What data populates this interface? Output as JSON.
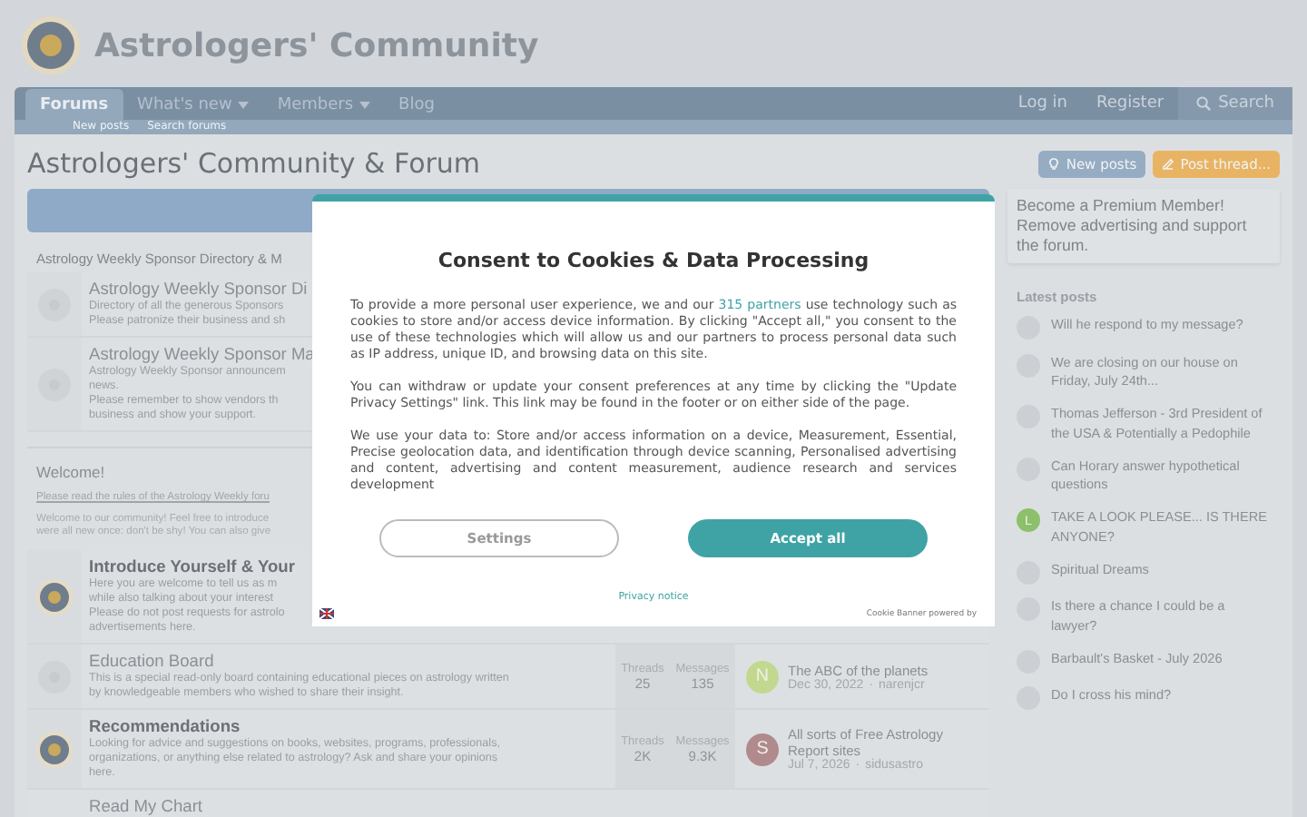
{
  "site": {
    "title": "Astrologers' Community"
  },
  "nav": {
    "tabs": [
      {
        "label": "Forums",
        "selected": true,
        "dropdown": false
      },
      {
        "label": "What's new",
        "selected": false,
        "dropdown": true
      },
      {
        "label": "Members",
        "selected": false,
        "dropdown": true
      },
      {
        "label": "Blog",
        "selected": false,
        "dropdown": false
      }
    ],
    "subnav": [
      "New posts",
      "Search forums"
    ],
    "actions": [
      "Log in",
      "Register"
    ],
    "search": "Search"
  },
  "page": {
    "title": "Astrologers' Community & Forum",
    "buttons": [
      {
        "label": "New posts",
        "kind": "secondary"
      },
      {
        "label": "Post thread...",
        "kind": "primary"
      }
    ]
  },
  "category": {
    "title": "Astrology Weekly Sponsor Directory & M",
    "forums": [
      {
        "title": "Astrology Weekly Sponsor Di",
        "unread": false,
        "lines": [
          "Directory of all the generous Sponsors",
          "Please patronize their business and sh"
        ]
      },
      {
        "title": "Astrology Weekly Sponsor Ma",
        "unread": false,
        "lines": [
          "Astrology Weekly Sponsor announcem",
          "news.",
          "Please remember to show vendors th",
          "business and show your support."
        ]
      }
    ]
  },
  "welcome": {
    "title": "Welcome!",
    "link": "Please read the rules of the Astrology Weekly foru",
    "lines": [
      "Welcome to our community! Feel free to introduce",
      "were all new once: don't be shy! You can also give"
    ]
  },
  "forums": [
    {
      "title": "Introduce Yourself & Your",
      "unread": true,
      "lines": [
        "Here you are welcome to tell us as m",
        "while also talking about your interest",
        "Please do not post requests for astrolo",
        "advertisements here."
      ]
    },
    {
      "title": "Education Board",
      "unread": false,
      "lines": [
        "This is a special read-only board containing educational pieces on astrology written",
        "by knowledgeable members who wished to share their insight."
      ],
      "threads_label": "Threads",
      "threads": "25",
      "messages_label": "Messages",
      "messages": "135",
      "last_post": {
        "title": "The ABC of the planets",
        "date": "Dec 30, 2022",
        "separator": "·",
        "user": "narenjcr",
        "avatar": {
          "letter": "N",
          "color": "#c3d88f"
        }
      }
    },
    {
      "title": "Recommendations",
      "unread": true,
      "lines": [
        "Looking for advice and suggestions on books, websites, programs, professionals,",
        "organizations, or anything else related to astrology? Ask and share your opinions",
        "here."
      ],
      "threads_label": "Threads",
      "threads": "2K",
      "messages_label": "Messages",
      "messages": "9.3K",
      "last_post": {
        "title": "All sorts of Free Astrology Report sites",
        "date": "Jul 7, 2026",
        "separator": "·",
        "user": "sidusastro",
        "avatar": {
          "letter": "S",
          "color": "#b08a8d"
        }
      }
    },
    {
      "title": "Read My Chart"
    }
  ],
  "sidebar": {
    "promo": "Become a Premium Member! Remove advertising and support the forum.",
    "latest_title": "Latest posts",
    "posts": [
      {
        "title": "Will he respond to my message?"
      },
      {
        "title": "We are closing on our house on Friday, July 24th..."
      },
      {
        "title": "Thomas Jefferson - 3rd President of the USA & Potentially a Pedophile"
      },
      {
        "title": "Can Horary answer hypothetical questions"
      },
      {
        "title": "TAKE A LOOK PLEASE... IS THERE ANYONE?",
        "avatar": {
          "letter": "L",
          "color": "#8cc06a"
        }
      },
      {
        "title": "Spiritual Dreams"
      },
      {
        "title": "Is there a chance I could be a lawyer?"
      },
      {
        "title": "Barbault's Basket - July 2026"
      },
      {
        "title": "Do I cross his mind?"
      }
    ]
  },
  "consent": {
    "title": "Consent to Cookies & Data Processing",
    "intro": {
      "before": "To provide a more personal user experience, we and our ",
      "link": "315 partners",
      "after": " use technology such as cookies to store and/or access device information. By clicking \"Accept all,\" you consent to the use of these technologies which will allow us and our partners to process personal data such as IP address, unique ID, and browsing data on this site."
    },
    "paragraphs": [
      "You can withdraw or update your consent preferences at any time by clicking the \"Update Privacy Settings\" link. This link may be found in the footer or on either side of the page.",
      "We use your data to: Store and/or access information on a device, Measurement, Essential, Precise geolocation data, and identification through device scanning, Personalised advertising and content, advertising and content measurement, audience research and services development"
    ],
    "buttons": [
      {
        "label": "Settings",
        "kind": "outline"
      },
      {
        "label": "Accept all",
        "kind": "primary"
      }
    ],
    "privacy": "Privacy notice",
    "powered": "Cookie Banner powered by"
  }
}
